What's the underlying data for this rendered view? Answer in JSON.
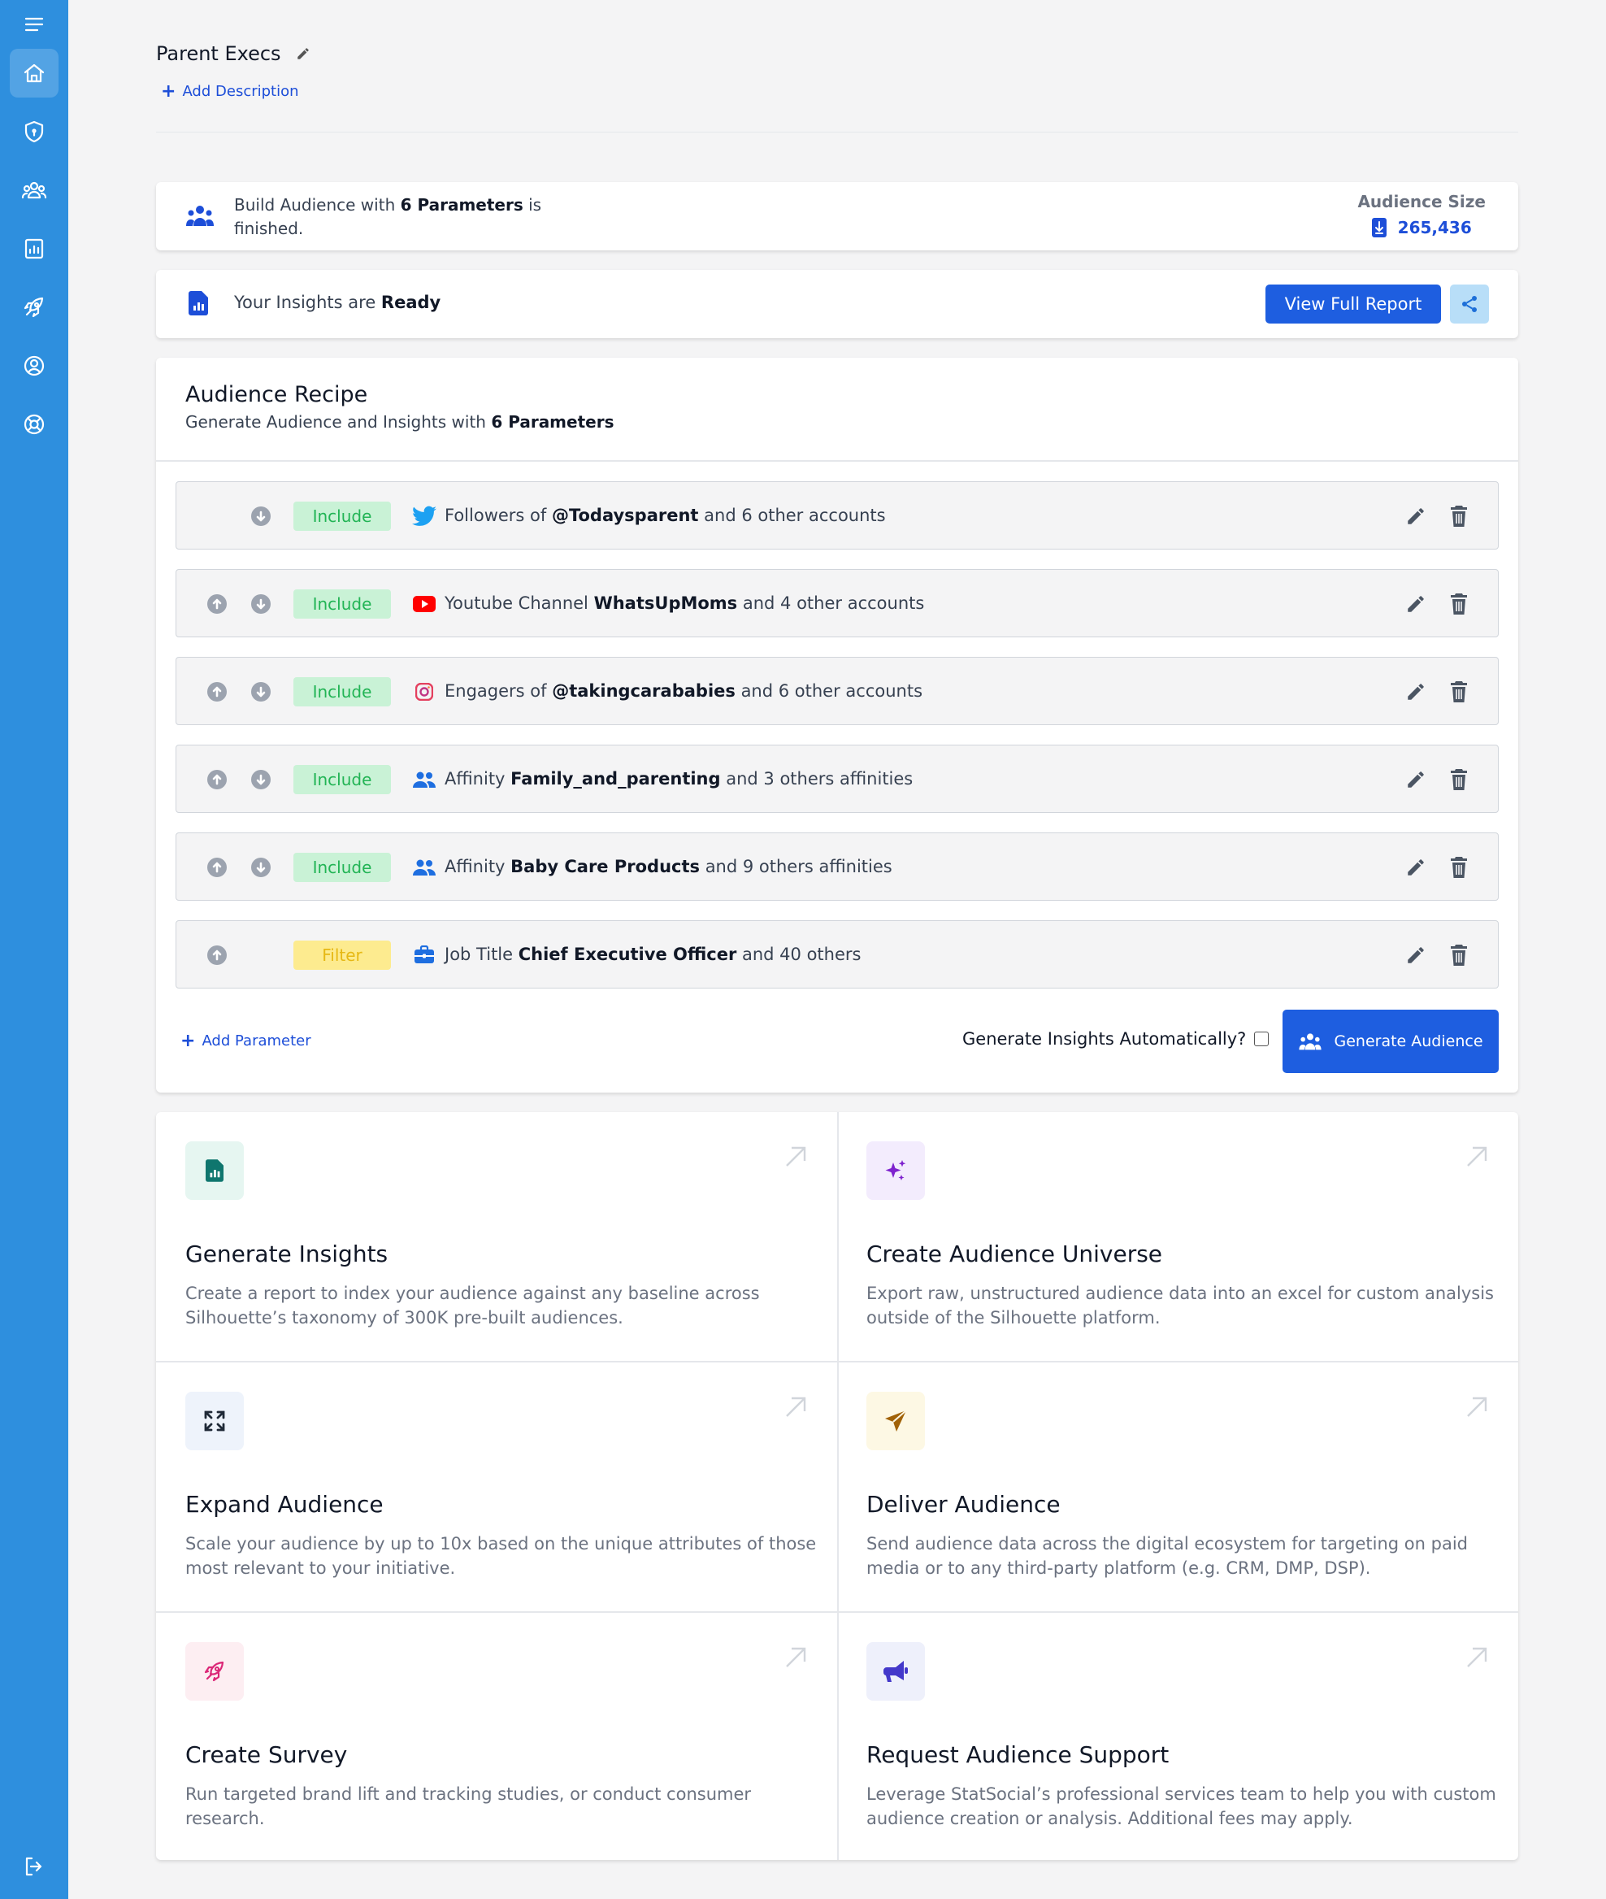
{
  "sidebar": {
    "icons": [
      "menu-icon",
      "home-icon",
      "shield-icon",
      "audience-icon",
      "report-icon",
      "rocket-icon",
      "user-icon",
      "support-icon",
      "logout-icon"
    ]
  },
  "header": {
    "title": "Parent Execs",
    "add_description": "Add Description"
  },
  "status": {
    "text_prefix": "Build Audience with ",
    "text_bold": "6 Parameters",
    "text_suffix": " is finished.",
    "audience_size_label": "Audience Size",
    "audience_size_value": "265,436"
  },
  "insights": {
    "text_prefix": "Your Insights are ",
    "text_bold": "Ready",
    "view_report_label": "View Full Report"
  },
  "recipe": {
    "title": "Audience Recipe",
    "subtitle_prefix": "Generate Audience and Insights with ",
    "subtitle_bold": "6 Parameters",
    "params": [
      {
        "tag": "Include",
        "icon": "twitter-icon",
        "prefix": "Followers of ",
        "bold": "@Todaysparent",
        "suffix": " and 6 other accounts"
      },
      {
        "tag": "Include",
        "icon": "youtube-icon",
        "prefix": "Youtube Channel ",
        "bold": "WhatsUpMoms",
        "suffix": " and 4 other accounts"
      },
      {
        "tag": "Include",
        "icon": "instagram-icon",
        "prefix": "Engagers of ",
        "bold": "@takingcarababies",
        "suffix": " and 6 other accounts"
      },
      {
        "tag": "Include",
        "icon": "people-icon",
        "prefix": "Affinity ",
        "bold": "Family_and_parenting",
        "suffix": " and 3 others affinities"
      },
      {
        "tag": "Include",
        "icon": "people-icon",
        "prefix": "Affinity ",
        "bold": "Baby Care Products",
        "suffix": " and 9 others affinities"
      },
      {
        "tag": "Filter",
        "icon": "briefcase-icon",
        "prefix": "Job Title ",
        "bold": "Chief Executive Officer",
        "suffix": " and 40 others"
      }
    ],
    "add_parameter": "Add Parameter",
    "generate_auto_label": "Generate Insights Automatically?",
    "generate_button": "Generate Audience"
  },
  "actions": [
    {
      "title": "Generate Insights",
      "desc": "Create a report to index your audience against any baseline across Silhouette’s taxonomy of 300K pre-built audiences.",
      "icon": "report-doc-icon",
      "icon_bg": "#e6f6f1",
      "icon_color": "#0f766e"
    },
    {
      "title": "Create Audience Universe",
      "desc": "Export raw, unstructured audience data into an excel for custom analysis outside of the Silhouette platform.",
      "icon": "sparkles-icon",
      "icon_bg": "#f3ecfd",
      "icon_color": "#7e22ce"
    },
    {
      "title": "Expand Audience",
      "desc": "Scale your audience by up to 10x based on the unique attributes of those most relevant to your initiative.",
      "icon": "expand-icon",
      "icon_bg": "#eef3fb",
      "icon_color": "#1f2937"
    },
    {
      "title": "Deliver Audience",
      "desc": "Send audience data across the digital ecosystem for targeting on paid media or to any third-party platform (e.g. CRM, DMP, DSP).",
      "icon": "send-icon",
      "icon_bg": "#fdf8e4",
      "icon_color": "#a16207"
    },
    {
      "title": "Create Survey",
      "desc": "Run targeted brand lift and tracking studies, or conduct consumer research.",
      "icon": "rocket-icon",
      "icon_bg": "#fdeef2",
      "icon_color": "#db2777"
    },
    {
      "title": "Request Audience Support",
      "desc": "Leverage StatSocial’s professional services team to help you with custom audience creation or analysis. Additional fees may apply.",
      "icon": "megaphone-icon",
      "icon_bg": "#eef0fb",
      "icon_color": "#4338ca"
    }
  ],
  "colors": {
    "sidebar": "#2e8fde",
    "primary": "#1e5ee0",
    "include_bg": "#c9f2d6",
    "include_text": "#22b455",
    "filter_bg": "#fdeb8f",
    "filter_text": "#e6b814"
  }
}
